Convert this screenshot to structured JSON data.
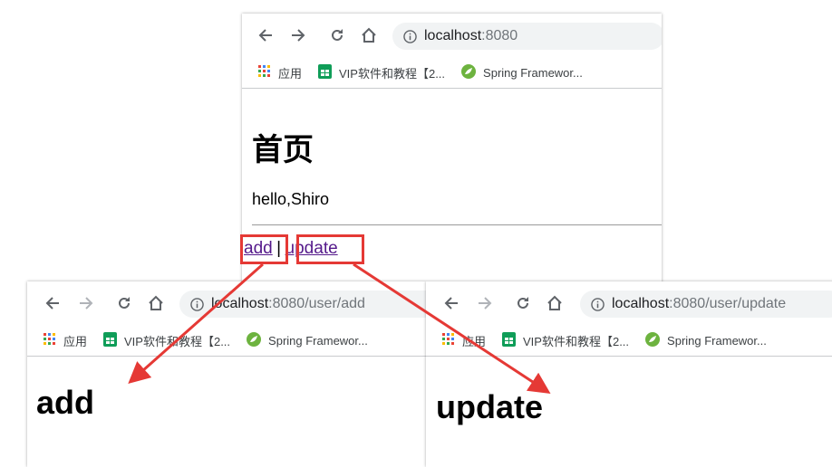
{
  "main_window": {
    "address": {
      "host": "localhost",
      "port_path": ":8080"
    },
    "bookmarks": [
      {
        "icon": "apps-grid-icon",
        "label": "应用"
      },
      {
        "icon": "sheets-icon",
        "label": "VIP软件和教程【2..."
      },
      {
        "icon": "spring-leaf-icon",
        "label": "Spring Framewor..."
      }
    ],
    "page": {
      "heading": "首页",
      "greeting": "hello,Shiro",
      "link_add": "add",
      "separator": "|",
      "link_update": "update"
    }
  },
  "add_window": {
    "address": {
      "host": "localhost",
      "port_path": ":8080/user/add"
    },
    "bookmarks": [
      {
        "icon": "apps-grid-icon",
        "label": "应用"
      },
      {
        "icon": "sheets-icon",
        "label": "VIP软件和教程【2..."
      },
      {
        "icon": "spring-leaf-icon",
        "label": "Spring Framewor..."
      }
    ],
    "page": {
      "heading": "add"
    }
  },
  "update_window": {
    "address": {
      "host": "localhost",
      "port_path": ":8080/user/update"
    },
    "bookmarks": [
      {
        "icon": "apps-grid-icon",
        "label": "应用"
      },
      {
        "icon": "sheets-icon",
        "label": "VIP软件和教程【2..."
      },
      {
        "icon": "spring-leaf-icon",
        "label": "Spring Framewor..."
      }
    ],
    "page": {
      "heading": "update"
    }
  },
  "colors": {
    "annotation_red": "#e53935",
    "link_visited": "#551a8b",
    "omnibox_bg": "#f1f3f4"
  }
}
